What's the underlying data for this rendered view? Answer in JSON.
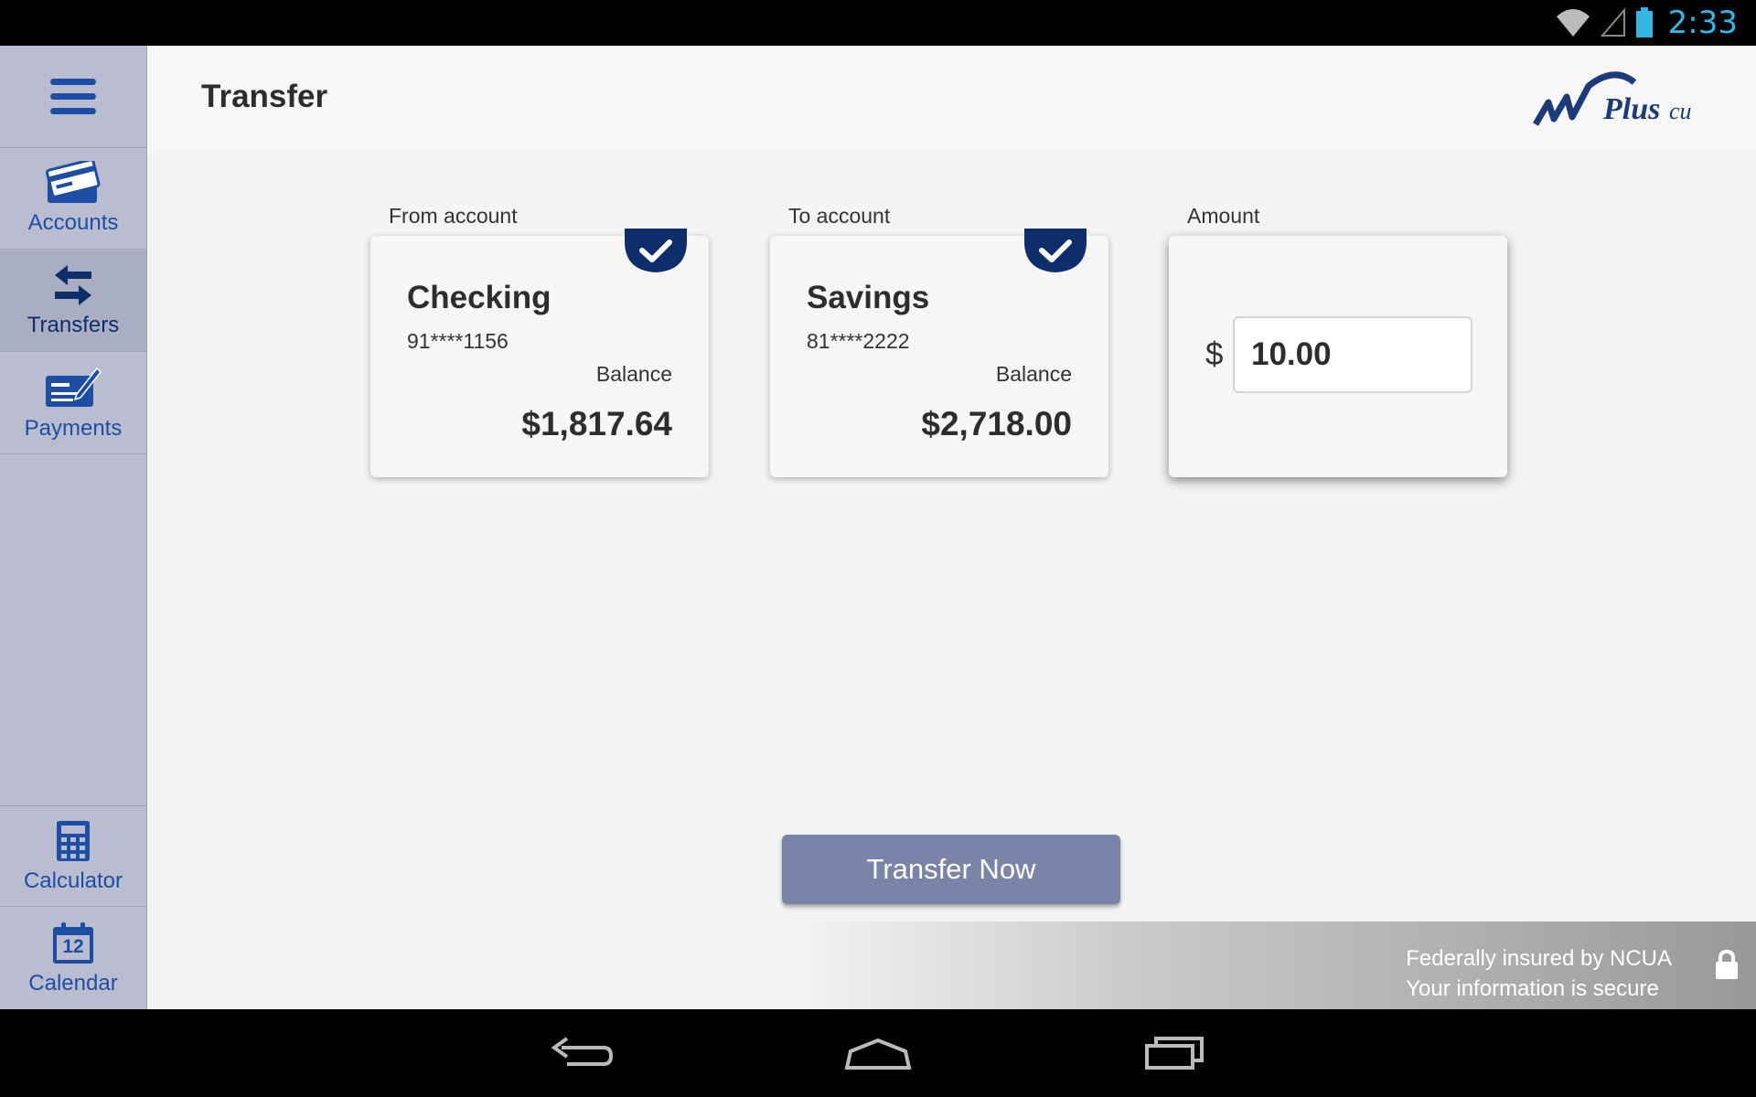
{
  "status_bar": {
    "time": "2:33"
  },
  "sidebar": {
    "items": [
      {
        "label": "Accounts",
        "icon": "credit-card-icon"
      },
      {
        "label": "Transfers",
        "icon": "transfer-arrows-icon"
      },
      {
        "label": "Payments",
        "icon": "check-payment-icon"
      },
      {
        "label": "Calculator",
        "icon": "calculator-icon"
      },
      {
        "label": "Calendar",
        "icon": "calendar-icon",
        "day": "12"
      }
    ],
    "active": "Transfers"
  },
  "header": {
    "title": "Transfer",
    "logo": "NWPlus cu"
  },
  "transfer": {
    "from_label": "From account",
    "to_label": "To account",
    "amount_label": "Amount",
    "from": {
      "name": "Checking",
      "number": "91****1156",
      "balance_label": "Balance",
      "balance": "$1,817.64"
    },
    "to": {
      "name": "Savings",
      "number": "81****2222",
      "balance_label": "Balance",
      "balance": "$2,718.00"
    },
    "currency_symbol": "$",
    "amount_value": "10.00",
    "button_label": "Transfer Now"
  },
  "footer": {
    "line1": "Federally insured by NCUA",
    "line2": "Your information is secure"
  },
  "colors": {
    "brand_navy": "#0e2d6b",
    "sidebar_bg": "#b9bdcf",
    "button_bg": "#7a84a8",
    "clock": "#33b5e5"
  }
}
